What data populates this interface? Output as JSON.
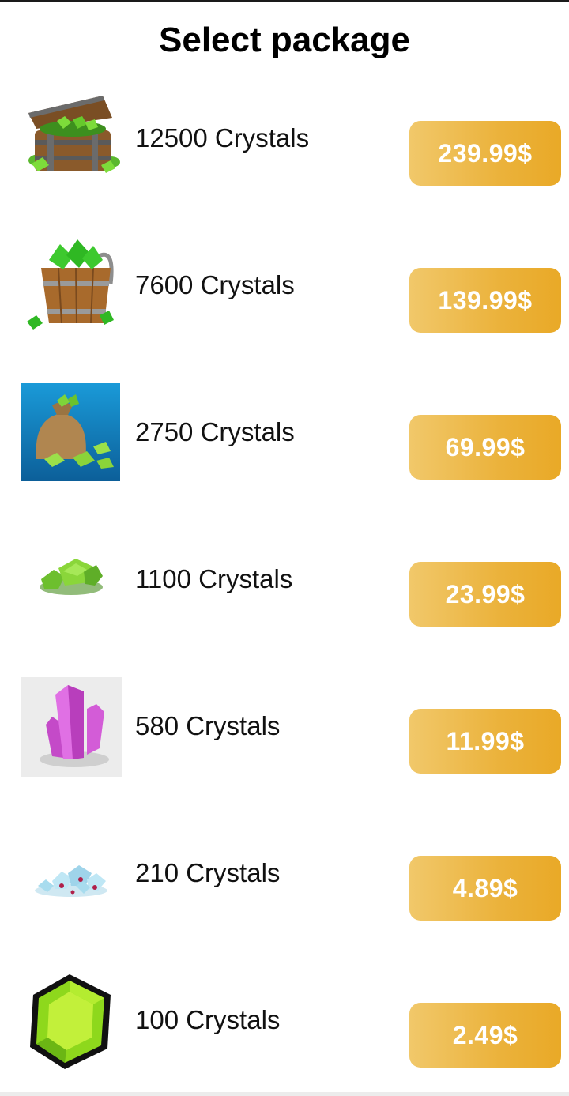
{
  "header": {
    "title": "Select package"
  },
  "packages": [
    {
      "name": "12500 Crystals",
      "price": "239.99$",
      "icon": "treasure-chest-icon"
    },
    {
      "name": "7600 Crystals",
      "price": "139.99$",
      "icon": "crystal-bucket-icon"
    },
    {
      "name": "2750 Crystals",
      "price": "69.99$",
      "icon": "crystal-sack-icon"
    },
    {
      "name": "1100 Crystals",
      "price": "23.99$",
      "icon": "crystal-pile-icon"
    },
    {
      "name": "580 Crystals",
      "price": "11.99$",
      "icon": "pink-crystal-icon"
    },
    {
      "name": "210 Crystals",
      "price": "4.89$",
      "icon": "gem-pile-icon"
    },
    {
      "name": "100 Crystals",
      "price": "2.49$",
      "icon": "green-hexagon-gem-icon"
    }
  ],
  "colors": {
    "button": "#ebb23b",
    "button_text": "#ffffff",
    "text": "#111111"
  }
}
